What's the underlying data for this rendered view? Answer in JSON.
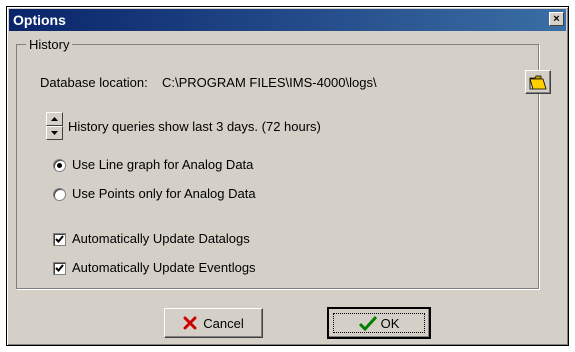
{
  "window": {
    "title": "Options",
    "close_label": "×"
  },
  "history": {
    "group_label": "History",
    "database_location_label": "Database location:",
    "database_location_value": "C:\\PROGRAM FILES\\IMS-4000\\logs\\",
    "query_text": "History queries show last 3 days. (72 hours)"
  },
  "graph_options": [
    {
      "label": "Use Line graph for Analog Data",
      "checked": true
    },
    {
      "label": "Use Points only for Analog Data",
      "checked": false
    }
  ],
  "update_options": [
    {
      "label": "Automatically Update Datalogs",
      "checked": true
    },
    {
      "label": "Automatically Update Eventlogs",
      "checked": true
    }
  ],
  "buttons": {
    "cancel_label": "Cancel",
    "ok_label": "OK"
  },
  "icons": {
    "browse": "folder-open-icon",
    "cancel": "x-icon",
    "ok": "checkmark-icon"
  },
  "colors": {
    "title_bar": "#0a246a",
    "dialog_bg": "#d4d0c8",
    "cancel_x": "#cc0000",
    "ok_check": "#008000"
  }
}
